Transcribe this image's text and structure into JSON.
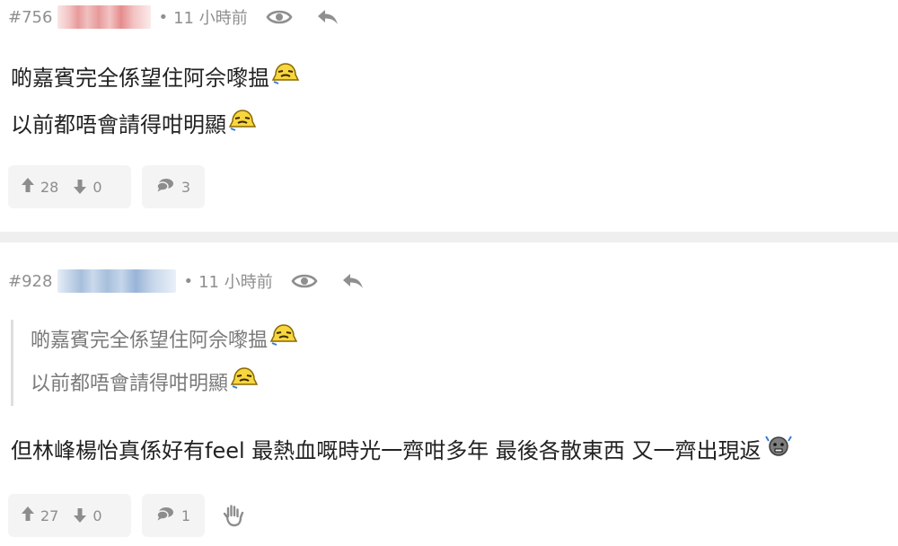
{
  "posts": [
    {
      "number": "#756",
      "dot": "•",
      "time": "11 小時前",
      "lines": [
        "啲嘉賓完全係望住阿佘嚟揾",
        "以前都唔會請得咁明顯"
      ],
      "upvotes": "28",
      "downvotes": "0",
      "comments": "3"
    },
    {
      "number": "#928",
      "dot": "•",
      "time": "11 小時前",
      "quote_lines": [
        "啲嘉賓完全係望住阿佘嚟揾",
        "以前都唔會請得咁明顯"
      ],
      "reply": "但林峰楊怡真係好有feel 最熱血嘅時光一齊咁多年 最後各散東西 又一齊出現返",
      "upvotes": "27",
      "downvotes": "0",
      "comments": "1"
    }
  ],
  "icons": {
    "view": "eye-icon",
    "reply": "reply-arrow-icon",
    "upvote": "arrow-up-icon",
    "downvote": "arrow-down-icon",
    "comment": "chat-bubble-icon",
    "raise_hand": "raised-hand-icon",
    "emoji_a": "yellow-bell-face-emoji",
    "emoji_b": "grey-sweat-face-emoji"
  },
  "colors": {
    "meta_text": "#8f8f8f",
    "button_bg": "#f4f4f4",
    "separator": "#efefef",
    "quote_text": "#7a7a7a"
  }
}
